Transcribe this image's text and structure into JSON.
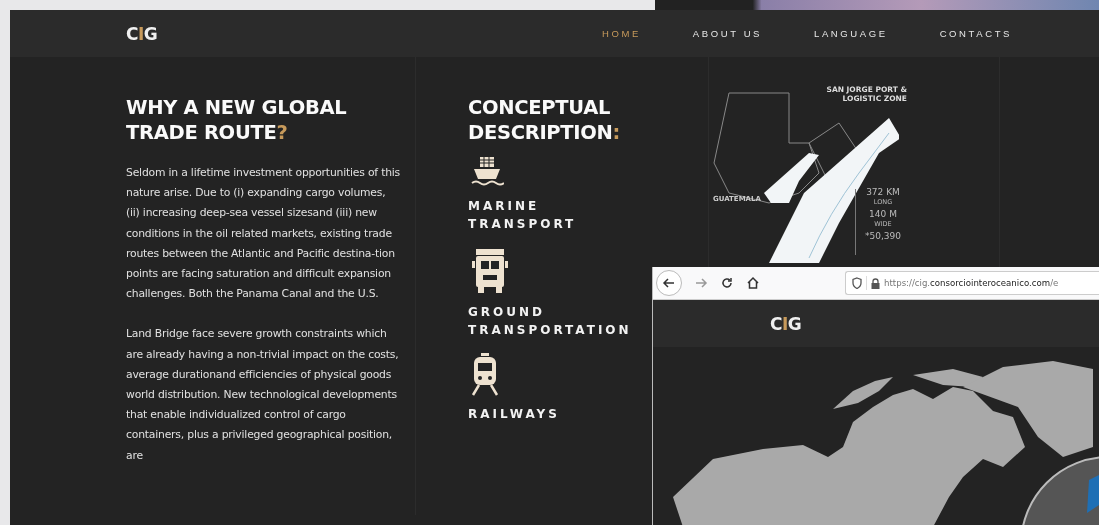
{
  "site": {
    "logo": [
      {
        "text": "C",
        "accent": false
      },
      {
        "text": "I",
        "accent": true
      },
      {
        "text": "G",
        "accent": false
      }
    ],
    "nav": [
      {
        "label": "HOME",
        "selected": true
      },
      {
        "label": "ABOUT US",
        "selected": false
      },
      {
        "label": "LANGUAGE",
        "selected": false
      },
      {
        "label": "CONTACTS",
        "selected": false
      }
    ]
  },
  "intro": {
    "title": "WHY A NEW GLOBAL TRADE ROUTE",
    "accent": "?",
    "paragraphs": [
      "Seldom in a lifetime investment opportunities of this nature arise. Due to (i) expanding cargo volumes, (ii) increasing deep-sea vessel sizesand (iii) new conditions in the oil related markets, existing trade routes between the Atlantic and Pacific destina-tion points are facing saturation and difficult expansion challenges. Both the Panama Canal and the U.S.",
      "Land Bridge face severe growth constraints which are already having a non-trivial impact on the costs, average durationand efficiencies of physical goods world distribution. New technological developments that enable individualized control of cargo containers, plus a privileged geographical position, are"
    ]
  },
  "concept": {
    "title": "CONCEPTUAL DESCRIPTION",
    "accent": ":",
    "items": [
      {
        "kind": "ship",
        "label": "MARINE TRANSPORT"
      },
      {
        "kind": "truck",
        "label": "GROUND TRANSPORTATION"
      },
      {
        "kind": "train",
        "label": "RAILWAYS"
      }
    ]
  },
  "map": {
    "port_label": "SAN JORGE PORT & LOGISTIC ZONE",
    "country_label": "GUATEMALA",
    "stats": [
      {
        "value": "372 KM",
        "unit": "LONG"
      },
      {
        "value": "140 M",
        "unit": "WIDE"
      },
      {
        "value": "*50,390"
      }
    ]
  },
  "browser": {
    "url": "https://cig.**consorciointeroceanico.com**/e",
    "logo": [
      {
        "text": "C",
        "accent": false
      },
      {
        "text": "I",
        "accent": true
      },
      {
        "text": "G",
        "accent": false
      }
    ]
  }
}
